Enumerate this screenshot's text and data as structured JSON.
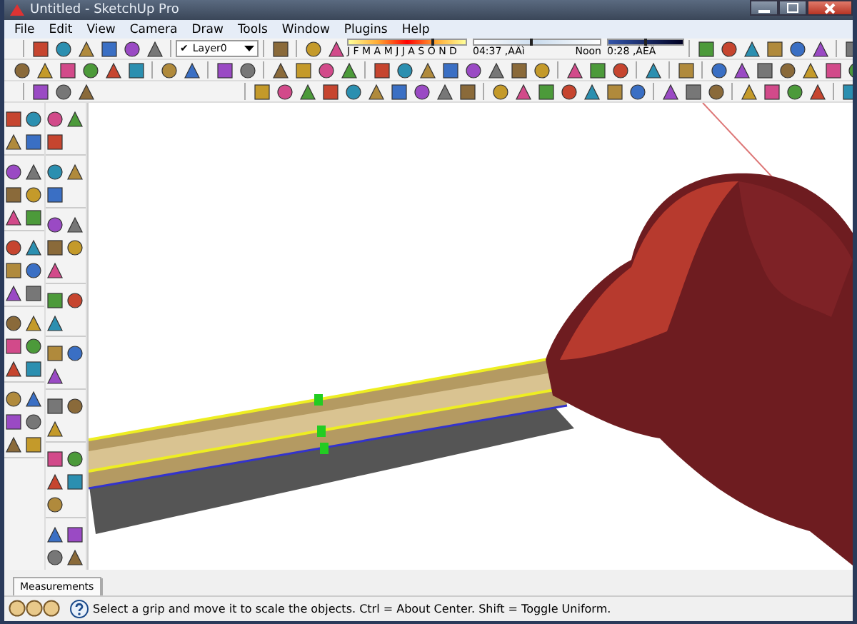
{
  "window": {
    "title": "Untitled - SketchUp Pro"
  },
  "menu": [
    "File",
    "Edit",
    "View",
    "Camera",
    "Draw",
    "Tools",
    "Window",
    "Plugins",
    "Help"
  ],
  "layer_dropdown": {
    "mark": "✔",
    "value": "Layer0"
  },
  "shadow_settings": {
    "month_slider": {
      "level": 0.72
    },
    "months": "J F M A M J J A S O N D",
    "time_slider": {
      "level": 0.45
    },
    "sunrise": "04:37 ,ÀÄì",
    "noon": "Noon",
    "sunset_slider": {
      "level": 0.5
    },
    "sunset": "0:28 ,ÀÈÄ"
  },
  "measurements": {
    "label": "Measurements"
  },
  "status_bar": {
    "text": "Select a grip and move it to scale the objects. Ctrl = About Center. Shift = Toggle Uniform."
  }
}
